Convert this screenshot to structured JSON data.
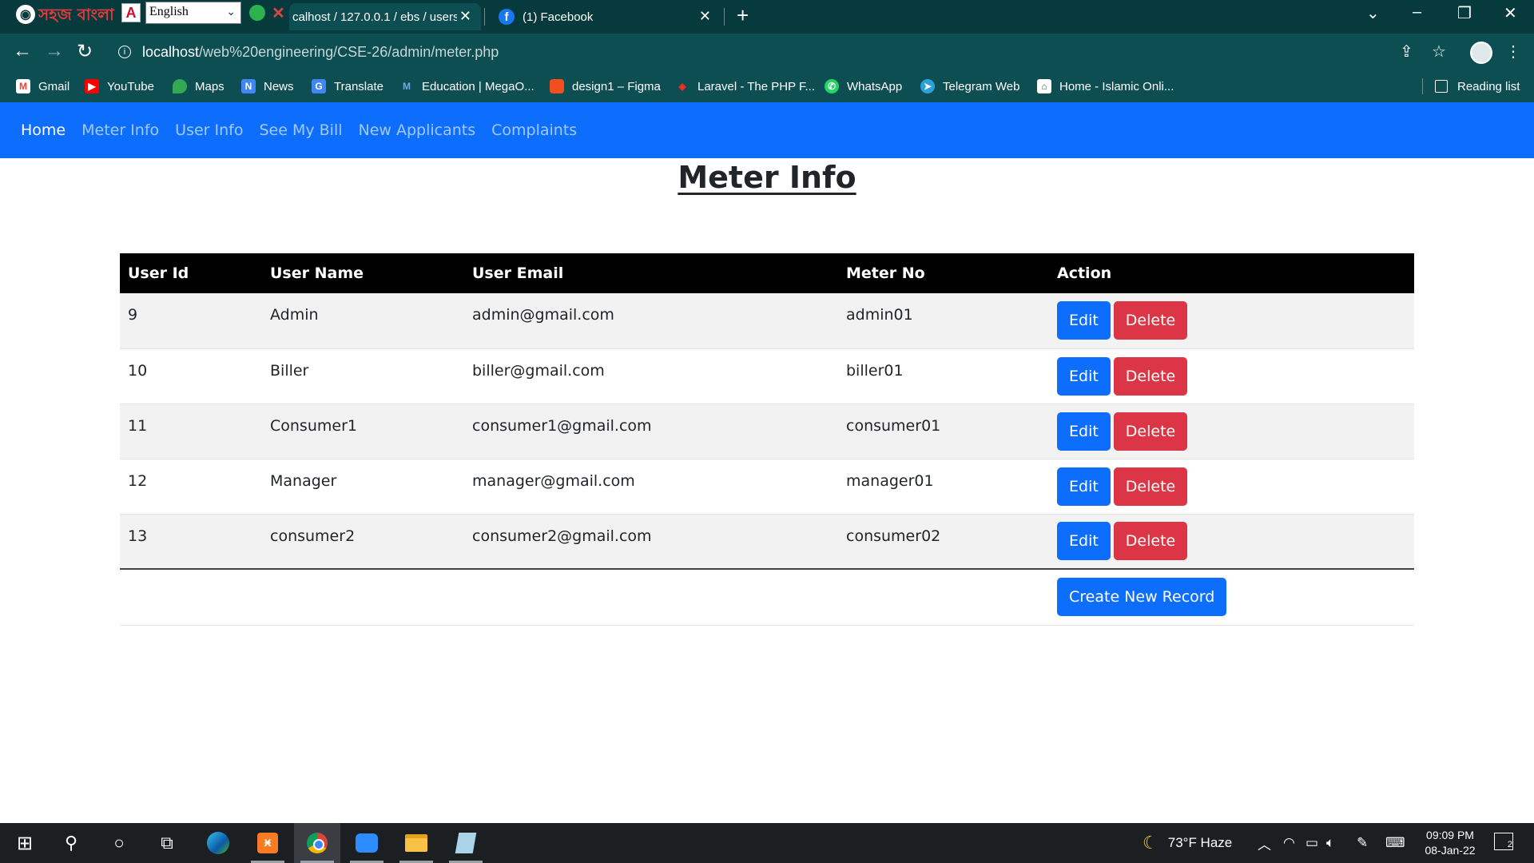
{
  "browser": {
    "extensions": {
      "bangla_label": "সহজ বাংলা",
      "language_value": "English"
    },
    "tabs": [
      {
        "title": "calhost / 127.0.0.1 / ebs / users",
        "active": true
      },
      {
        "title": "(1) Facebook",
        "active": false
      }
    ],
    "address": {
      "host": "localhost",
      "path": "/web%20engineering/CSE-26/admin/meter.php"
    },
    "bookmarks": [
      {
        "label": "Gmail",
        "icon": "gmail-icon"
      },
      {
        "label": "YouTube",
        "icon": "youtube-icon"
      },
      {
        "label": "Maps",
        "icon": "maps-icon"
      },
      {
        "label": "News",
        "icon": "news-icon"
      },
      {
        "label": "Translate",
        "icon": "translate-icon"
      },
      {
        "label": "Education | MegaO...",
        "icon": "megaowl-icon"
      },
      {
        "label": "design1 – Figma",
        "icon": "figma-icon"
      },
      {
        "label": "Laravel - The PHP F...",
        "icon": "laravel-icon"
      },
      {
        "label": "WhatsApp",
        "icon": "whatsapp-icon"
      },
      {
        "label": "Telegram Web",
        "icon": "telegram-icon"
      },
      {
        "label": "Home - Islamic Onli...",
        "icon": "islamic-online-icon"
      }
    ],
    "reading_list": "Reading list"
  },
  "nav": {
    "items": [
      "Home",
      "Meter Info",
      "User Info",
      "See My Bill",
      "New Applicants",
      "Complaints"
    ],
    "active": "Home"
  },
  "page": {
    "title": "Meter Info"
  },
  "table": {
    "headers": [
      "User Id",
      "User Name",
      "User Email",
      "Meter No",
      "Action"
    ],
    "rows": [
      {
        "id": "9",
        "name": "Admin",
        "email": "admin@gmail.com",
        "meter": "admin01"
      },
      {
        "id": "10",
        "name": "Biller",
        "email": "biller@gmail.com",
        "meter": "biller01"
      },
      {
        "id": "11",
        "name": "Consumer1",
        "email": "consumer1@gmail.com",
        "meter": "consumer01"
      },
      {
        "id": "12",
        "name": "Manager",
        "email": "manager@gmail.com",
        "meter": "manager01"
      },
      {
        "id": "13",
        "name": "consumer2",
        "email": "consumer2@gmail.com",
        "meter": "consumer02"
      }
    ],
    "edit_label": "Edit",
    "delete_label": "Delete",
    "create_label": "Create New Record"
  },
  "taskbar": {
    "weather": "73°F  Haze",
    "time": "09:09 PM",
    "date": "08-Jan-22",
    "notifications": "2"
  },
  "colors": {
    "nav_bg": "#0d6efd",
    "edit": "#0d6efd",
    "delete": "#dc3545",
    "header_bg": "#000000",
    "chrome_bg": "#0d4e52"
  }
}
